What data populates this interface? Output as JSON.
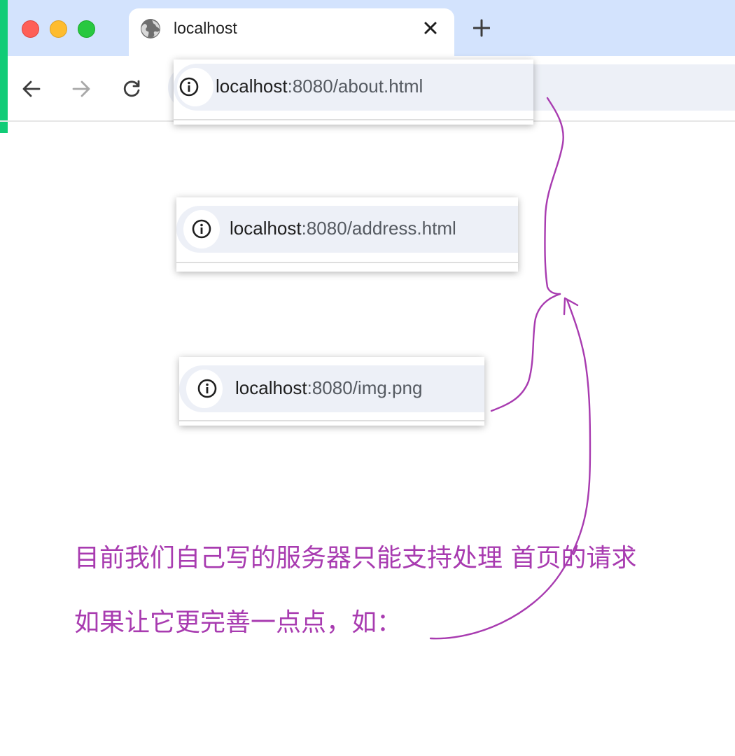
{
  "browser": {
    "tab": {
      "title": "localhost",
      "icon": "globe-icon"
    },
    "new_tab_icon": "plus-icon",
    "nav": {
      "back_icon": "back-arrow-icon",
      "forward_icon": "forward-arrow-icon",
      "reload_icon": "reload-icon"
    }
  },
  "url_popups": [
    {
      "host": "localhost",
      "rest": ":8080/about.html",
      "icon": "info-icon"
    },
    {
      "host": "localhost",
      "rest": ":8080/address.html",
      "icon": "info-icon"
    },
    {
      "host": "localhost",
      "rest": ":8080/img.png",
      "icon": "info-icon"
    }
  ],
  "annotation": {
    "line1": "目前我们自己写的服务器只能支持处理 首页的请求",
    "line2": "如果让它更完善一点点，如：",
    "color": "#a83bb0"
  },
  "colors": {
    "tabbar": "#d3e3fd",
    "omnibox": "#edf0f7",
    "accent_strip": "#11cc77"
  }
}
